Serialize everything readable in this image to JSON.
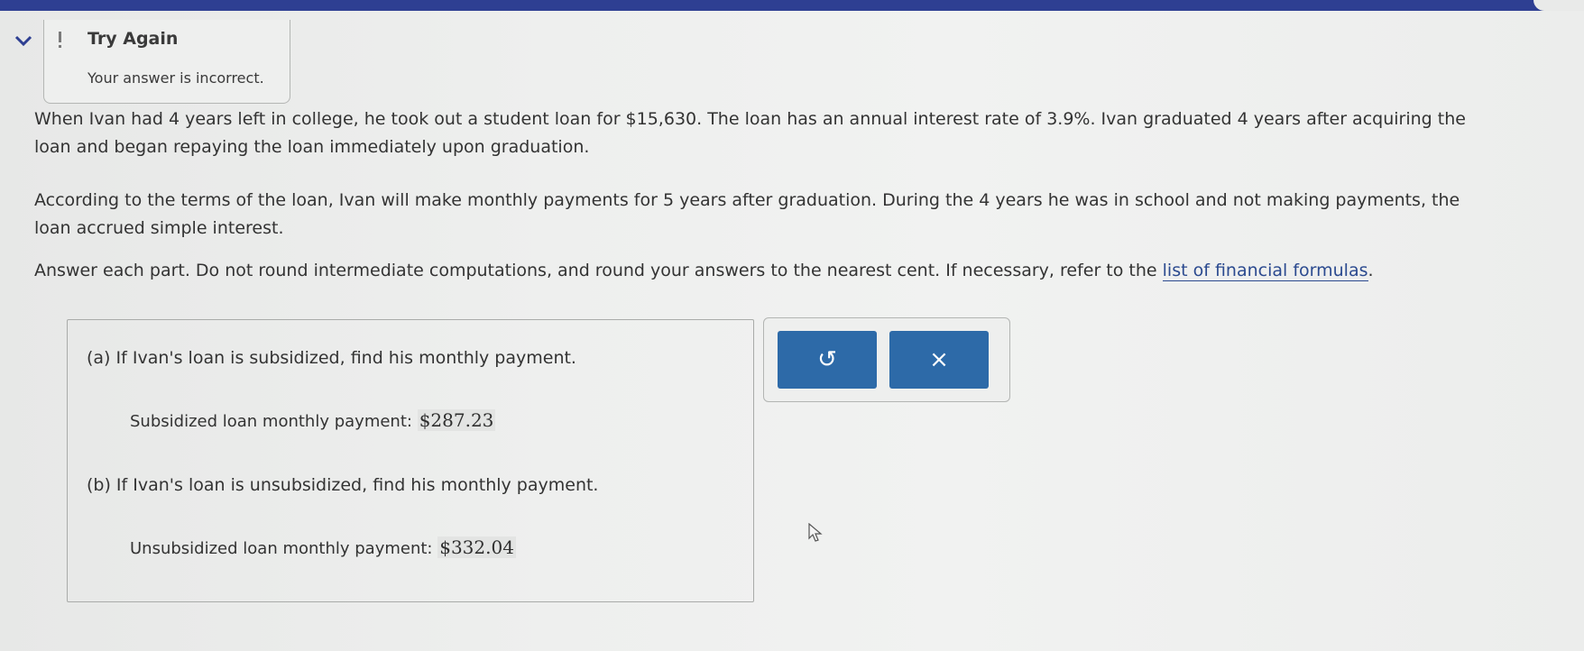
{
  "feedback": {
    "title": "Try Again",
    "message": "Your answer is incorrect."
  },
  "problem": {
    "paragraph1": "When Ivan had 4 years left in college, he took out a student loan for $15,630. The loan has an annual interest rate of 3.9%. Ivan graduated 4 years after acquiring the loan and began repaying the loan immediately upon graduation.",
    "paragraph2": "According to the terms of the loan, Ivan will make monthly payments for 5 years after graduation. During the 4 years he was in school and not making payments, the loan accrued simple interest.",
    "paragraph3_text": "Answer each part. Do not round intermediate computations, and round your answers to the nearest cent. If necessary, refer to the ",
    "paragraph3_link": "list of financial formulas",
    "paragraph3_end": "."
  },
  "parts": {
    "a": {
      "question": "(a) If Ivan's loan is subsidized, find his monthly payment.",
      "label": "Subsidized loan monthly payment:",
      "value": "$287.23"
    },
    "b": {
      "question": "(b) If Ivan's loan is unsubsidized, find his monthly payment.",
      "label": "Unsubsidized loan monthly payment:",
      "value": "$332.04"
    }
  },
  "buttons": {
    "reset_symbol": "↺",
    "clear_symbol": "×"
  },
  "icons": {
    "chevron": "chevron-down-icon",
    "warning": "warning-icon",
    "reset": "undo-icon",
    "clear": "close-icon",
    "cursor": "mouse-pointer-icon"
  },
  "colors": {
    "header_bar": "#2e3f92",
    "button": "#2d6aa8",
    "link": "#2b4a8f"
  }
}
